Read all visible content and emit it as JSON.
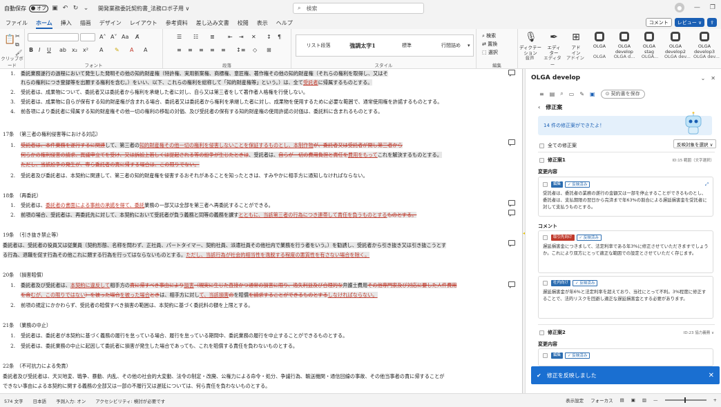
{
  "titlebar": {
    "autosave_label": "自動保存",
    "autosave_state": "オフ",
    "doc_title": "開発業務委託契約書_法務ロボ子用 ∨",
    "search_placeholder": "検索"
  },
  "menu": {
    "items": [
      "ファイル",
      "ホーム",
      "挿入",
      "描画",
      "デザイン",
      "レイアウト",
      "参考資料",
      "差し込み文書",
      "校閲",
      "表示",
      "ヘルプ"
    ],
    "comment_btn": "コメント",
    "review_btn": "レビュー ∨"
  },
  "ribbon": {
    "group_labels": [
      "クリップボード",
      "フォント",
      "段落",
      "スタイル",
      "編集",
      "音声",
      "エディター",
      "アドイン",
      "OLGA",
      "OLGA d...",
      "OLGA...",
      "OLGA dev...",
      "OLGA dev..."
    ],
    "styles": [
      "リスト段落",
      "強調太字1",
      "標準",
      "行間詰め"
    ],
    "edit_items": [
      "検索",
      "置換",
      "選択"
    ],
    "addins": [
      {
        "label": "ディクテー\nション"
      },
      {
        "label": "エディ\nター"
      },
      {
        "label": "アド\nイン"
      },
      {
        "label": "OLGA"
      },
      {
        "label": "OLGA\ndevelop"
      },
      {
        "label": "OLGA\nstag"
      },
      {
        "label": "OLGA\ndevelop2"
      },
      {
        "label": "OLGA\ndevelop3"
      }
    ]
  },
  "document": {
    "p1": "委託業務遂行の過程において発生した発明その他の知的財産権（特許権、実用新案権、商標権、意匠権、著作権その他の知的財産権（それらの権利を取得し、又はそ",
    "p1b": "れらの権利につき登録等を出願する権利を含む。）をいい、以下、これらの権利を総称して「知的財産権等」という。）は、全て",
    "p1b_red": "受託者",
    "p1b_end": "に帰属するものとする。",
    "l2": "受託者は、成果物について、委託者又は委託者から権利を承継した者に対し、自ら又は第三者をして著作者人格権を行使しない。",
    "l3": "受託者は、成果物に自らが保有する知的財産権が含まれる場合、委託者又は委託者から権利を承継した者に対し、成果物を使用するために必要な範囲で、通常使用権を許諾するものとする。",
    "l4": "前各項により委託者に帰属する知的財産権その他一切の権利の移転の対価、及び受託者の保有する知的財産権の使用許諾の対価は、委託料に含まれるものとする。",
    "art17": "17条　（第三者の権利侵害等における対応）",
    "a17_1a": "受託者は、本件業務を遂行するに",
    "a17_1b": "関連",
    "a17_1c": "して、第三者の",
    "a17_1d": "知的財産権",
    "a17_1e": "その他一切の権利を侵害しないことを保証するものと",
    "a17_1f": "し、本制作物",
    "a17_1g": "が、委託者又は受託者が開し第三者から",
    "a17_2": "何らかの権利侵害の請求、異議申立てを受け、又は訴訟上若しくは",
    "a17_2b": "提起される等の紛争が生じたときは",
    "a17_2c": "、受託者は、",
    "a17_2d": "自らが一切の費用負担と責任を",
    "a17_2e": "費用をもって",
    "a17_2f": "これを解決するものとする。",
    "a17_3": "ただし、当該紛争の発生が、専ら委託者の責に帰する場合は、この限りでない。",
    "a17_4": "受託者及び委託者は、本契約に関連して、第三者の知的財産権を侵害するおそれがあることを知ったときは、すみやかに相手方に通知しなければならない。",
    "art18": "18条　（再委託）",
    "a18_1a": "受託者は、",
    "a18_1b": "委託者の書面による事前の承諾を得て、委託",
    "a18_1c": "業務の一部又は全部を第三者へ再委託することができる。",
    "a18_2a": "前項の場合、受託者は、再委託先に対して、本契約において受託者が負う義務と同等の義務を課す",
    "a18_2b": "とともに、当該第三者の行為につき連帯して責任を負うものとする",
    "a18_2c": "ものとする。",
    "art19": "19条　（引き抜き禁止等）",
    "a19_1": "委託者は、受託者の役員又は従業員（契約形態、名称を問わず、正社員、パートタイマー、契約社員、派遣社員その他社内で業務を行う者をいう。）を勧誘し、受託者から引き抜き又は引き抜こうとす",
    "a19_2a": "る行為、退職を促す行為その他これに類する行為を行ってはならないものとする。",
    "a19_2b": "ただし、当該行為が社会的相当性を逸脱する程度の悪質性を有さない場合を除く。",
    "art20": "20条　（損害賠償）",
    "a20_1a": "委託者及び受託者は、",
    "a20_1b": "本契約に違反して",
    "a20_1c": "相手方の",
    "a20_1d": "責に帰すべき事由により",
    "a20_1e": "損害",
    "a20_1f": "（現実に生じた直接かつ通常の損害に限り、逸失利益及び合理的な",
    "a20_1g": "弁護士費用",
    "a20_1h": "その他専門家及び対応に要した人件費用",
    "a20_2a": "を含",
    "a20_2b": "むが、この限りではない",
    "a20_2c": "）を被った場合",
    "a20_2d": "を被った場合",
    "a20_2e": "とき",
    "a20_2f": "は、相手方に対し",
    "a20_2g": "て",
    "a20_2h": "、当該損害",
    "a20_2i": "の",
    "a20_2j": "を賠償",
    "a20_2k": "を請求することができるものとする",
    "a20_2l": "しなければならない。",
    "a20_3": "前項の規定にかかわらず、受託者の賠償すべき損害の範囲は、本契約に基づく委託料の額を上限とする。",
    "art21": "21条　（業務の中止）",
    "a21_1": "受託者は、委託者が本契約に基づく義務の履行を怠っている場合、履行を怠っている期間中、委託業務の履行を中止することができるものとする。",
    "a21_2": "受託者は、委託業務の中止に起因して委託者に損害が発生した場合であっても、これを賠償する責任を負わないものとする。",
    "art22": "22条　（不可抗力による免責）",
    "a22_1": "委託者及び受託者は、天災地変、戦争、暴動、内乱、その他の社会的大変動、法令の制定・改廃、公権力による命令・処分、争議行為、輸送機関・通信回線の事故、その他当事者の責に帰することが",
    "a22_2": "できない事由による本契約に関する義務の全部又は一部の不履行又は遅延については、何ら責任を負わないものとする。"
  },
  "panel": {
    "title": "OLGA develop",
    "save_btn": "契約書を保存",
    "back_label": "修正案",
    "banner": "14 件の修正案ができたよ！",
    "select_all": "全ての修正案",
    "bulk_select": "反映対象を選択 ∨",
    "proposal1": "修正案1",
    "proposal1_meta": "ID:15 範囲（文字選択）",
    "change_label": "変更内容",
    "tag_edit": "編集",
    "tag_reflected": "✓ 反映済み",
    "change_text": "受託者は、委託者の業務の遂行の金額又は一部を停止することができるものとし、委託者は、支払期限の翌日から完済まで年63%の割合による遅延損害金を受託者に対して支払うものとする。",
    "comment_label": "コメント",
    "tag_external": "取引先向け",
    "comment1": "遅延損害金につきまして、法定利率である年3%に修正させていただきますでしょうか。これにより双方にとって適正な範囲での設定とさせていただく存じます。",
    "tag_internal": "社内向け",
    "comment2": "遅延損害金が年6%と法定利率を超えており、当社にとって不利。3%程度に修正することで、法的リスクを回避し適正な遅延損害金とする必要があります。",
    "proposal2": "修正案2",
    "proposal2_meta": "ID:23 協力義務 ∨",
    "change_label2": "変更内容",
    "toast": "修正を反映しました"
  },
  "status": {
    "words": "574 文字",
    "lang": "日本語",
    "predict": "予測入力: オン",
    "access": "アクセシビリティ: 検討が必要です",
    "display": "表示設定",
    "focus": "フォーカス"
  }
}
